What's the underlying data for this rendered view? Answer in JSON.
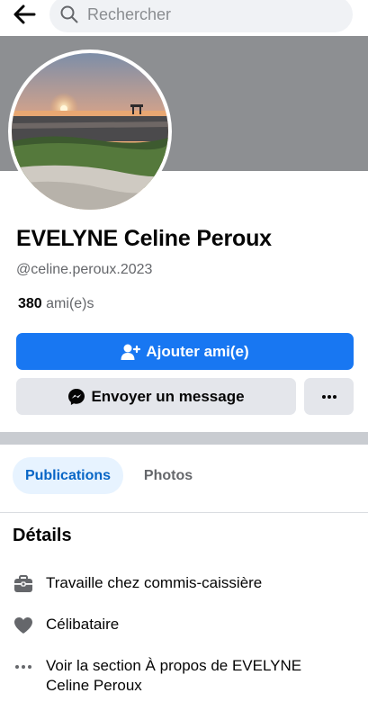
{
  "header": {
    "search_placeholder": "Rechercher"
  },
  "profile": {
    "name": "EVELYNE Celine Peroux",
    "handle": "@celine.peroux.2023",
    "friends_count": "380",
    "friends_label": "ami(e)s"
  },
  "actions": {
    "add_friend": "Ajouter ami(e)",
    "send_message": "Envoyer un message"
  },
  "tabs": [
    {
      "label": "Publications",
      "active": true
    },
    {
      "label": "Photos",
      "active": false
    }
  ],
  "details": {
    "title": "Détails",
    "items": [
      {
        "icon": "briefcase-icon",
        "text": "Travaille chez commis-caissière"
      },
      {
        "icon": "heart-icon",
        "text": "Célibataire"
      },
      {
        "icon": "more-dots-icon",
        "text": "Voir la section À propos de EVELYNE Celine Peroux"
      }
    ]
  },
  "colors": {
    "primary": "#1877f2",
    "secondary_button": "#e4e6eb",
    "active_tab_bg": "#e7f3ff",
    "active_tab_text": "#0866c6",
    "cover": "#8d8f92"
  }
}
